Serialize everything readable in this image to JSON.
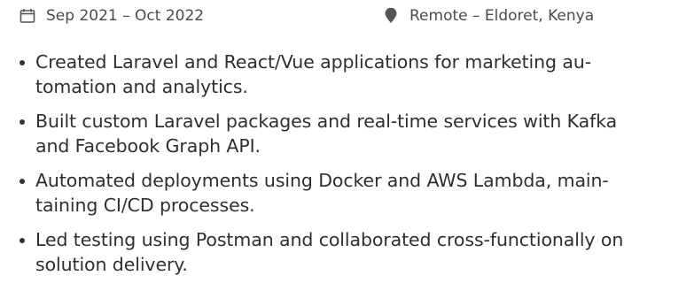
{
  "colors": {
    "text": "#2f2f2f",
    "meta_text": "#4b4b4b",
    "icon": "#555555"
  },
  "meta": {
    "date_icon": "calendar-icon",
    "date_range": "Sep 2021 – Oct 2022",
    "location_icon": "map-pin-icon",
    "location": "Remote – Eldoret, Kenya"
  },
  "bullets": [
    {
      "line1": "Created Laravel and React/Vue applications for marketing au-",
      "line2": "tomation and analytics."
    },
    {
      "line1": "Built custom Laravel packages and real-time services with Kafka",
      "line2": "and Facebook Graph API."
    },
    {
      "line1": "Automated deployments using Docker and AWS Lambda, main-",
      "line2": "taining CI/CD processes."
    },
    {
      "line1": "Led testing using Postman and collaborated cross-functionally on",
      "line2": "solution delivery."
    }
  ]
}
